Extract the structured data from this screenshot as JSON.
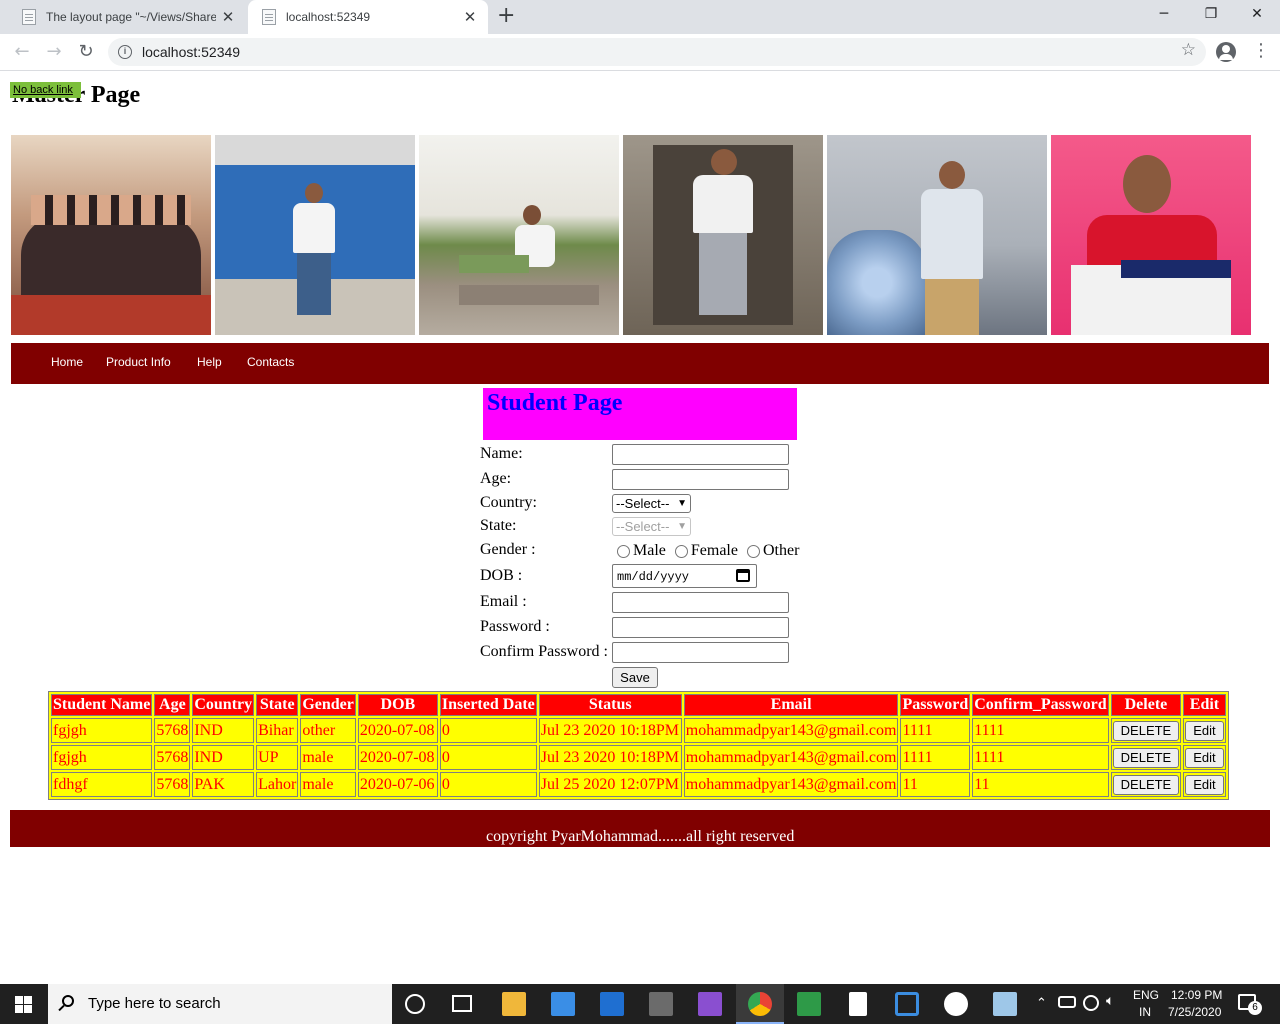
{
  "browser": {
    "tabs": [
      {
        "title": "The layout page \"~/Views/Shared",
        "active": false
      },
      {
        "title": "localhost:52349",
        "active": true
      }
    ],
    "url": "localhost:52349"
  },
  "page": {
    "back_link": "No back link",
    "master_heading": "Master Page",
    "photos": [
      "group-photo",
      "man-at-blackboard",
      "man-sitting-on-bench",
      "man-at-door",
      "man-with-flowers",
      "man-red-shirt"
    ],
    "nav": [
      "Home",
      "Product Info",
      "Help",
      "Contacts"
    ],
    "student_title": "Student Page",
    "form": {
      "name_label": "Name:",
      "age_label": "Age:",
      "country_label": "Country:",
      "country_value": "--Select--",
      "state_label": "State:",
      "state_value": "--Select--",
      "gender_label": "Gender :",
      "gender_options": [
        "Male",
        "Female",
        "Other"
      ],
      "dob_label": "DOB :",
      "dob_placeholder": "mm/dd/yyyy",
      "email_label": "Email :",
      "password_label": "Password :",
      "confirm_label": "Confirm Password :",
      "save_label": "Save"
    },
    "table": {
      "headers": [
        "Student Name",
        "Age",
        "Country",
        "State",
        "Gender",
        "DOB",
        "Inserted Date",
        "Status",
        "Email",
        "Password",
        "Confirm_Password",
        "Delete",
        "Edit"
      ],
      "rows": [
        [
          "fgjgh",
          "5768",
          "IND",
          "Bihar",
          "other",
          "2020-07-08",
          "0",
          "Jul 23 2020 10:18PM",
          "mohammadpyar143@gmail.com",
          "1111",
          "1111"
        ],
        [
          "fgjgh",
          "5768",
          "IND",
          "UP",
          "male",
          "2020-07-08",
          "0",
          "Jul 23 2020 10:18PM",
          "mohammadpyar143@gmail.com",
          "1111",
          "1111"
        ],
        [
          "fdhgf",
          "5768",
          "PAK",
          "Lahor",
          "male",
          "2020-07-06",
          "0",
          "Jul 25 2020 12:07PM",
          "mohammadpyar143@gmail.com",
          "11",
          "11"
        ]
      ],
      "delete_label": "DELETE",
      "edit_label": "Edit"
    },
    "footer": "copyright PyarMohammad.......all right reserved"
  },
  "taskbar": {
    "search_placeholder": "Type here to search",
    "lang": "ENG",
    "region": "IN",
    "time": "12:09 PM",
    "date": "7/25/2020",
    "notifications": "6"
  },
  "colors": {
    "nav_bg": "#800000",
    "title_bg": "#ff00ff",
    "title_fg": "#0000ff",
    "table_bg": "#ffff00",
    "table_header_bg": "#ff0000",
    "backlink_bg": "#7cbf3b"
  }
}
